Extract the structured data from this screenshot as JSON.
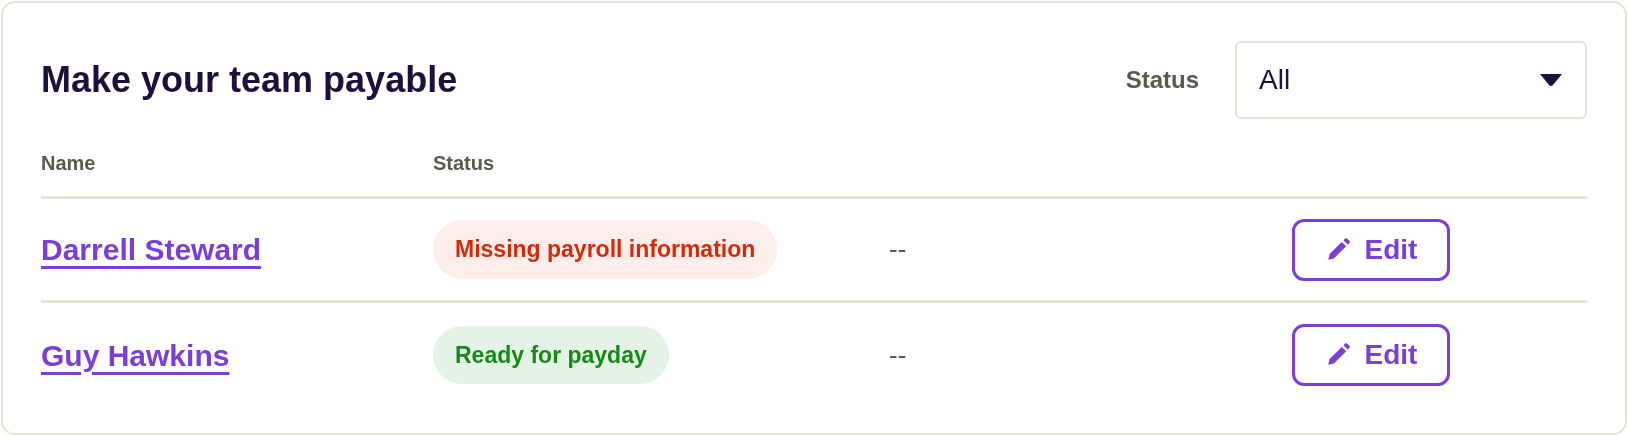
{
  "title": "Make your team payable",
  "filter": {
    "label": "Status",
    "value": "All"
  },
  "table": {
    "columns": [
      "Name",
      "Status"
    ],
    "rows": [
      {
        "name": "Darrell Steward",
        "status": {
          "text": "Missing payroll information",
          "kind": "error"
        },
        "column_3": "--",
        "action": "Edit"
      },
      {
        "name": "Guy Hawkins",
        "status": {
          "text": "Ready for payday",
          "kind": "success"
        },
        "column_3": "--",
        "action": "Edit"
      }
    ]
  }
}
